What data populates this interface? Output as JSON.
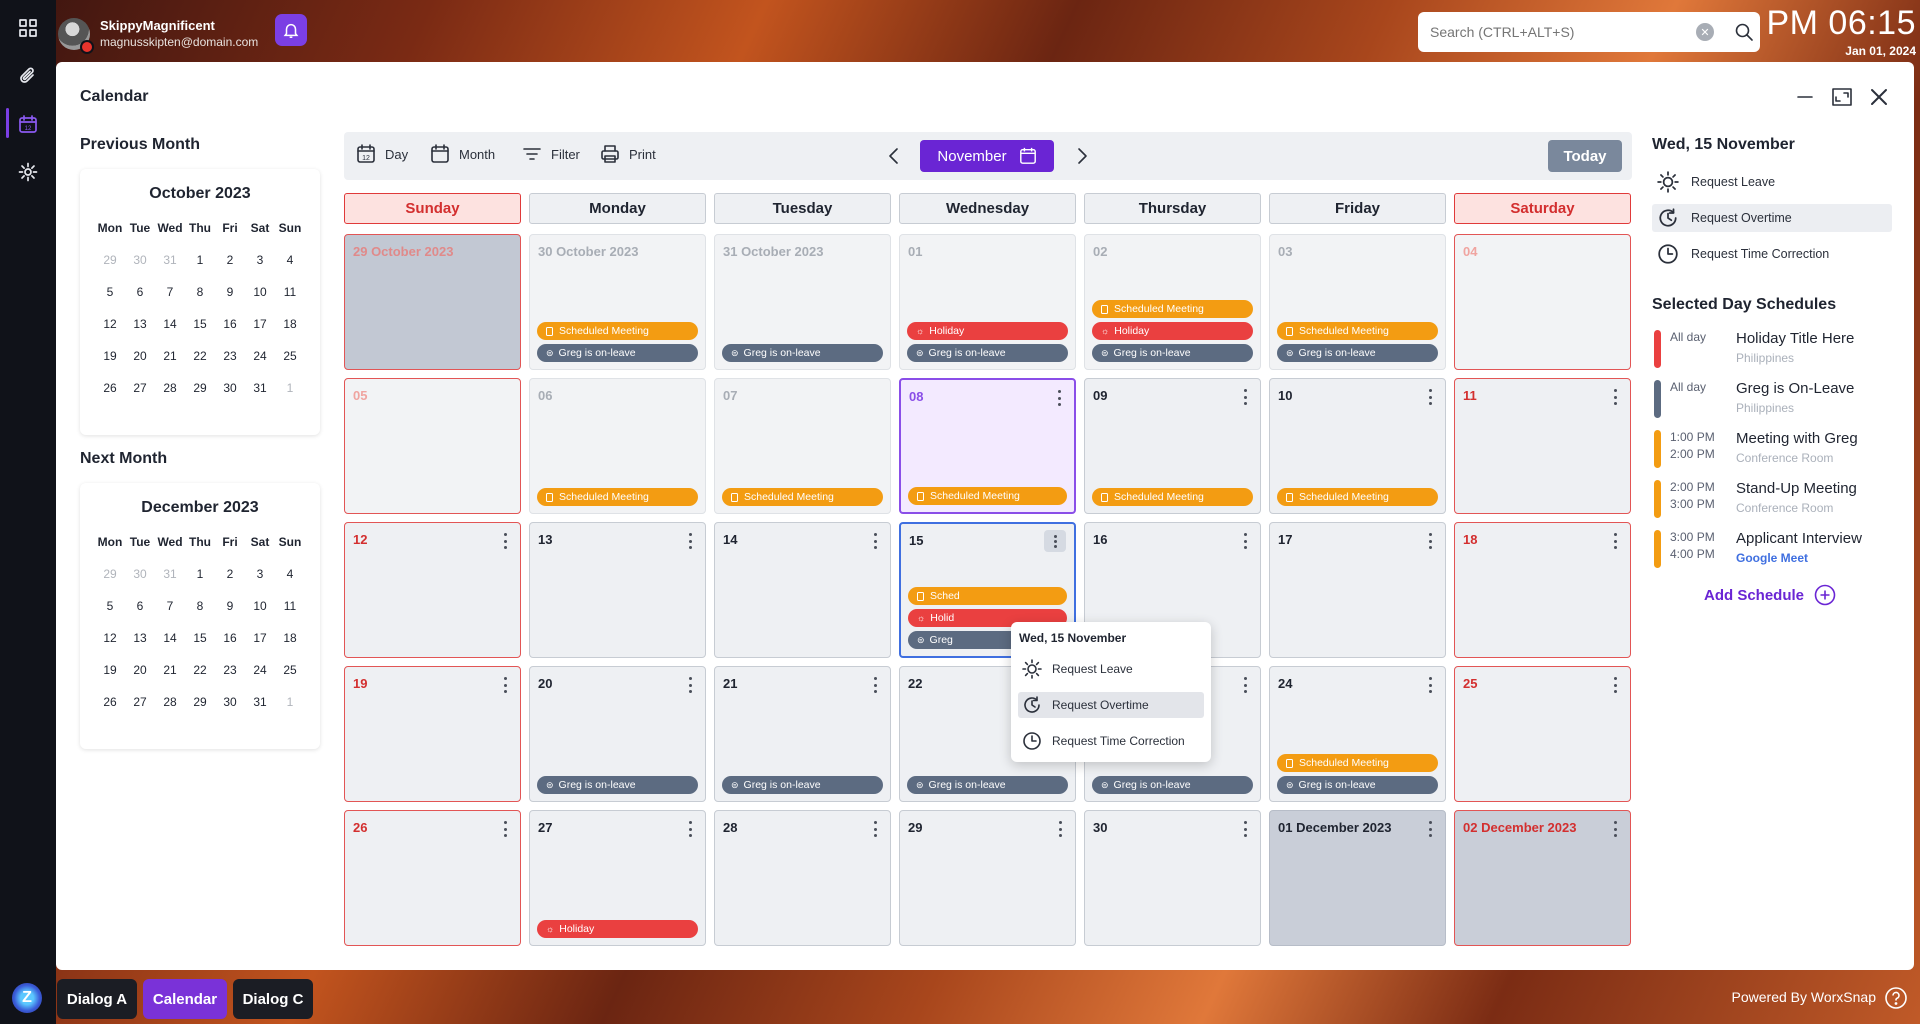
{
  "user": {
    "name": "SkippyMagnificent",
    "email": "magnusskipten@domain.com"
  },
  "search": {
    "placeholder": "Search (CTRL+ALT+S)"
  },
  "clock": {
    "time": "PM 06:15",
    "date": "Jan 01, 2024"
  },
  "window": {
    "title": "Calendar"
  },
  "left": {
    "prev_title": "Previous Month",
    "next_title": "Next Month",
    "weekdays": [
      "Mon",
      "Tue",
      "Wed",
      "Thu",
      "Fri",
      "Sat",
      "Sun"
    ],
    "oct": {
      "title": "October 2023",
      "days": [
        "29",
        "30",
        "31",
        "1",
        "2",
        "3",
        "4",
        "5",
        "6",
        "7",
        "8",
        "9",
        "10",
        "11",
        "12",
        "13",
        "14",
        "15",
        "16",
        "17",
        "18",
        "19",
        "20",
        "21",
        "22",
        "23",
        "24",
        "25",
        "26",
        "27",
        "28",
        "29",
        "30",
        "31",
        "1"
      ]
    },
    "dec": {
      "title": "December 2023",
      "days": [
        "29",
        "30",
        "31",
        "1",
        "2",
        "3",
        "4",
        "5",
        "6",
        "7",
        "8",
        "9",
        "10",
        "11",
        "12",
        "13",
        "14",
        "15",
        "16",
        "17",
        "18",
        "19",
        "20",
        "21",
        "22",
        "23",
        "24",
        "25",
        "26",
        "27",
        "28",
        "29",
        "30",
        "31",
        "1"
      ]
    }
  },
  "toolbar": {
    "day": "Day",
    "month": "Month",
    "filter": "Filter",
    "print": "Print",
    "current_month": "November",
    "today": "Today"
  },
  "calendar": {
    "headers": [
      "Sunday",
      "Monday",
      "Tuesday",
      "Wednesday",
      "Thursday",
      "Friday",
      "Saturday"
    ],
    "weeks": [
      [
        {
          "d": "29 October 2023",
          "s": "dim shade we",
          "e": []
        },
        {
          "d": "30 October 2023",
          "s": "dim",
          "e": [
            "m",
            "l"
          ]
        },
        {
          "d": "31 October 2023",
          "s": "dim",
          "e": [
            "l"
          ]
        },
        {
          "d": "01",
          "s": "dim",
          "e": [
            "h",
            "l"
          ]
        },
        {
          "d": "02",
          "s": "dim",
          "e": [
            "m",
            "h",
            "l"
          ]
        },
        {
          "d": "03",
          "s": "dim",
          "e": [
            "m",
            "l"
          ]
        },
        {
          "d": "04",
          "s": "dim we",
          "e": []
        }
      ],
      [
        {
          "d": "05",
          "s": "dim we",
          "e": []
        },
        {
          "d": "06",
          "s": "dim",
          "e": [
            "m"
          ]
        },
        {
          "d": "07",
          "s": "dim",
          "e": [
            "m"
          ]
        },
        {
          "d": "08",
          "s": "today8",
          "k": 1,
          "e": [
            "m"
          ]
        },
        {
          "d": "09",
          "s": "",
          "k": 1,
          "e": [
            "m"
          ]
        },
        {
          "d": "10",
          "s": "",
          "k": 1,
          "e": [
            "m"
          ]
        },
        {
          "d": "11",
          "s": "we",
          "k": 1,
          "e": []
        }
      ],
      [
        {
          "d": "12",
          "s": "we",
          "k": 1,
          "e": []
        },
        {
          "d": "13",
          "s": "",
          "k": 1,
          "e": []
        },
        {
          "d": "14",
          "s": "",
          "k": 1,
          "e": []
        },
        {
          "d": "15",
          "s": "sel",
          "k": 2,
          "e": [
            "m",
            "h",
            "l"
          ]
        },
        {
          "d": "16",
          "s": "",
          "k": 1,
          "e": []
        },
        {
          "d": "17",
          "s": "",
          "k": 1,
          "e": []
        },
        {
          "d": "18",
          "s": "we",
          "k": 1,
          "e": []
        }
      ],
      [
        {
          "d": "19",
          "s": "we",
          "k": 1,
          "e": []
        },
        {
          "d": "20",
          "s": "",
          "k": 1,
          "e": [
            "l"
          ]
        },
        {
          "d": "21",
          "s": "",
          "k": 1,
          "e": [
            "l"
          ]
        },
        {
          "d": "22",
          "s": "",
          "k": 1,
          "e": [
            "l"
          ]
        },
        {
          "d": "23",
          "s": "",
          "k": 1,
          "e": [
            "l"
          ]
        },
        {
          "d": "24",
          "s": "",
          "k": 1,
          "e": [
            "m",
            "l"
          ]
        },
        {
          "d": "25",
          "s": "we",
          "k": 1,
          "e": []
        }
      ],
      [
        {
          "d": "26",
          "s": "we",
          "k": 1,
          "e": []
        },
        {
          "d": "27",
          "s": "",
          "k": 1,
          "e": [
            "h"
          ]
        },
        {
          "d": "28",
          "s": "",
          "k": 1,
          "e": []
        },
        {
          "d": "29",
          "s": "",
          "k": 1,
          "e": []
        },
        {
          "d": "30",
          "s": "",
          "k": 1,
          "e": []
        },
        {
          "d": "01 December 2023",
          "s": "shade",
          "k": 1,
          "e": []
        },
        {
          "d": "02 December 2023",
          "s": "shade we",
          "k": 1,
          "e": []
        }
      ]
    ],
    "event_labels": {
      "m": "Scheduled Meeting",
      "h": "Holiday",
      "l": "Greg is on-leave"
    },
    "event_colors": {
      "m": "#f39c12",
      "h": "#ea4040",
      "l": "#5c6b81"
    },
    "partial_15": {
      "m": "Sched",
      "h": "Holid",
      "l": "Greg"
    }
  },
  "popup": {
    "title": "Wed, 15 November",
    "items": [
      "Request Leave",
      "Request Overtime",
      "Request Time Correction"
    ]
  },
  "right": {
    "date": "Wed, 15 November",
    "actions": [
      "Request Leave",
      "Request Overtime",
      "Request Time Correction"
    ],
    "schedules_title": "Selected Day Schedules",
    "schedules": [
      {
        "t1": "All day",
        "t2": "",
        "name": "Holiday Title Here",
        "sub": "Philippines",
        "color": "#ea4040"
      },
      {
        "t1": "All day",
        "t2": "",
        "name": "Greg is On-Leave",
        "sub": "Philippines",
        "color": "#5c6b81"
      },
      {
        "t1": "1:00 PM",
        "t2": "2:00 PM",
        "name": "Meeting with Greg",
        "sub": "Conference Room",
        "color": "#f39c12"
      },
      {
        "t1": "2:00 PM",
        "t2": "3:00 PM",
        "name": "Stand-Up Meeting",
        "sub": "Conference Room",
        "color": "#f39c12"
      },
      {
        "t1": "3:00 PM",
        "t2": "4:00 PM",
        "name": "Applicant Interview",
        "sub": "Google Meet",
        "color": "#f39c12",
        "link": true
      }
    ],
    "add": "Add Schedule"
  },
  "taskbar": {
    "tabs": [
      "Dialog A",
      "Calendar",
      "Dialog C"
    ],
    "powered": "Powered By WorxSnap"
  }
}
